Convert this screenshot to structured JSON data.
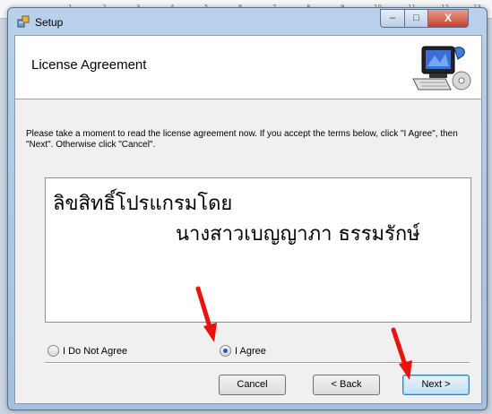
{
  "ruler": {
    "numbers": [
      "1",
      "2",
      "3",
      "4",
      "5",
      "6",
      "7",
      "8",
      "9",
      "10",
      "11",
      "12",
      "13"
    ]
  },
  "window": {
    "title": "Setup",
    "controls": {
      "minimize": "–",
      "maximize": "□",
      "close": "X"
    }
  },
  "header": {
    "title": "License Agreement"
  },
  "description": "Please take a moment to read the license agreement now. If you accept the terms below, click \"I Agree\", then \"Next\". Otherwise click \"Cancel\".",
  "license": {
    "line1": "ลิขสิทธิ์โปรแกรมโดย",
    "line2": "นางสาวเบญญาภา  ธรรมรักษ์"
  },
  "options": {
    "disagree": "I Do Not Agree",
    "agree": "I Agree",
    "selected": "agree"
  },
  "buttons": {
    "cancel": "Cancel",
    "back": "< Back",
    "next": "Next >"
  },
  "colors": {
    "annotation_arrow": "#e8130c",
    "window_frame": "#b9d1ea"
  }
}
